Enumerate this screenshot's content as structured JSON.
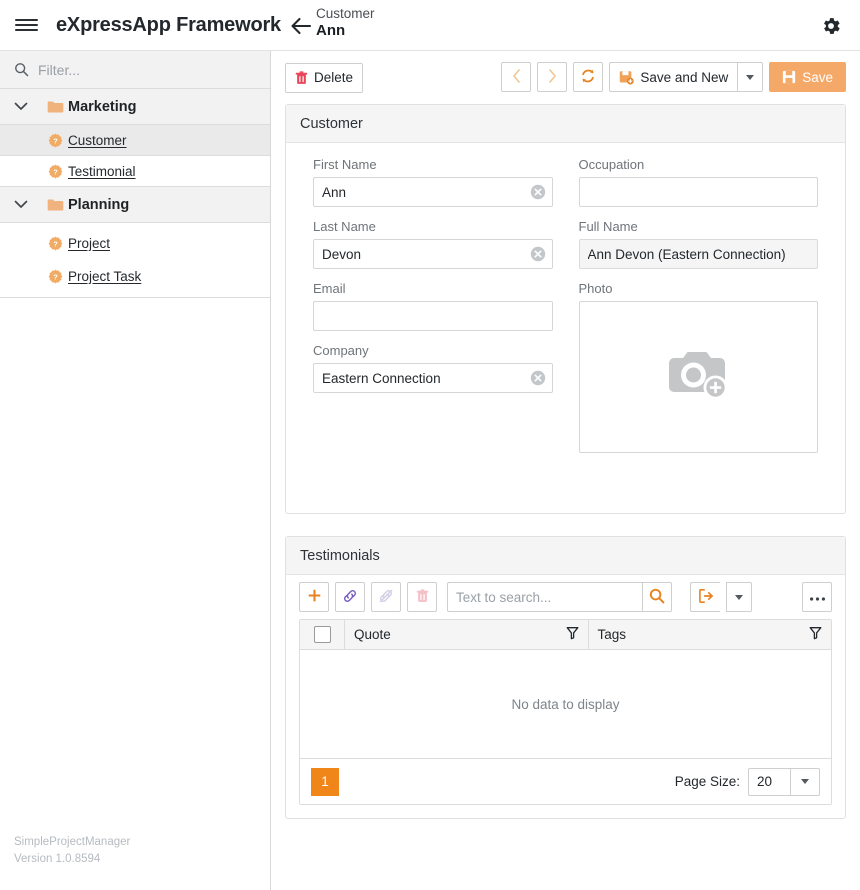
{
  "app": {
    "brand": "eXpressApp Framework",
    "hamburger_icon": "hamburger-menu-icon",
    "settings_icon": "gear-icon"
  },
  "breadcrumb": {
    "back_icon": "back-arrow-icon",
    "type": "Customer",
    "record": "Ann"
  },
  "sidebar": {
    "filter": {
      "placeholder": "Filter...",
      "value": "",
      "icon": "search-icon"
    },
    "groups": [
      {
        "label": "Marketing",
        "expanded": true,
        "items": [
          {
            "label": "Customer",
            "selected": true
          },
          {
            "label": "Testimonial",
            "selected": false
          }
        ]
      },
      {
        "label": "Planning",
        "expanded": true,
        "items": [
          {
            "label": "Project",
            "selected": false
          },
          {
            "label": "Project Task",
            "selected": false
          }
        ]
      }
    ],
    "footer": {
      "product": "SimpleProjectManager",
      "version": "Version 1.0.8594"
    }
  },
  "toolbar": {
    "delete_label": "Delete",
    "delete_icon": "trash-icon",
    "prev_icon": "chevron-left-icon",
    "next_icon": "chevron-right-icon",
    "refresh_icon": "refresh-icon",
    "save_new_label": "Save and New",
    "save_new_icon": "save-new-icon",
    "save_new_dropdown_icon": "chevron-down-icon",
    "save_label": "Save",
    "save_icon": "floppy-disk-icon"
  },
  "customer_card": {
    "title": "Customer",
    "fields": {
      "first_name": {
        "label": "First Name",
        "value": "Ann",
        "clearable": true
      },
      "last_name": {
        "label": "Last Name",
        "value": "Devon",
        "clearable": true
      },
      "email": {
        "label": "Email",
        "value": "",
        "clearable": false
      },
      "company": {
        "label": "Company",
        "value": "Eastern Connection",
        "clearable": true
      },
      "occupation": {
        "label": "Occupation",
        "value": "",
        "clearable": false
      },
      "full_name": {
        "label": "Full Name",
        "value": "Ann Devon (Eastern Connection)",
        "readonly": true
      },
      "photo": {
        "label": "Photo",
        "icon": "camera-add-icon"
      }
    }
  },
  "testimonials_card": {
    "title": "Testimonials",
    "toolbar": {
      "new_icon": "plus-icon",
      "link_icon": "link-icon",
      "unlink_icon": "unlink-icon",
      "delete_icon": "trash-icon",
      "search_placeholder": "Text to search...",
      "search_value": "",
      "search_icon": "search-icon",
      "export_icon": "export-icon",
      "export_dropdown_icon": "chevron-down-icon",
      "more_icon": "ellipsis-icon"
    },
    "grid": {
      "select_all_checkbox": false,
      "columns": [
        {
          "label": "Quote",
          "filter_icon": "filter-icon"
        },
        {
          "label": "Tags",
          "filter_icon": "filter-icon"
        }
      ],
      "rows": [],
      "empty_text": "No data to display"
    },
    "footer": {
      "current_page": "1",
      "page_size_label": "Page Size:",
      "page_size_value": "20",
      "page_size_dropdown_icon": "chevron-down-icon"
    }
  },
  "colors": {
    "accent_orange": "#f08519",
    "accent_orange_light": "#f5a968",
    "link_purple": "#7b5fc0",
    "delete_red": "#e8455a",
    "text_dark": "#23282d"
  }
}
